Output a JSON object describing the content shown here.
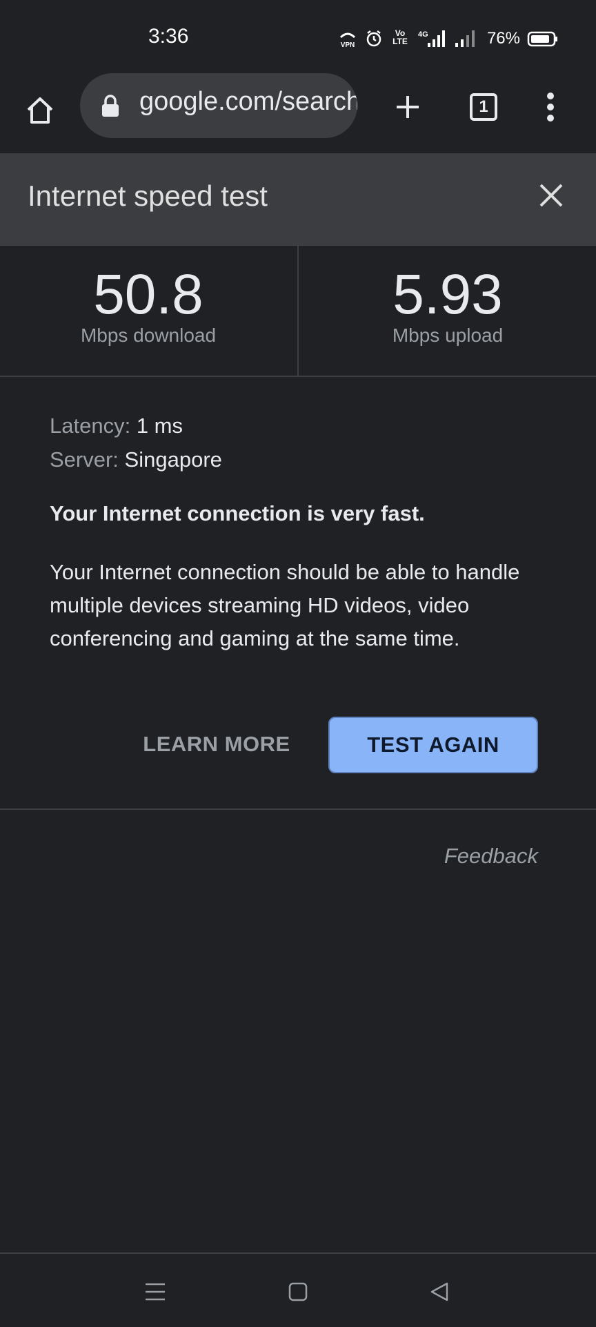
{
  "status_bar": {
    "time": "3:36",
    "battery_percent": "76%",
    "icons": [
      "vpn-icon",
      "alarm-icon",
      "volte-icon",
      "4g-signal-icon",
      "signal-icon",
      "battery-icon"
    ],
    "vpn_label": "VPN",
    "volte_label": "Vo LTE",
    "network_label": "4G"
  },
  "toolbar": {
    "url": "google.com/search",
    "tab_count": "1",
    "icons": [
      "home-icon",
      "lock-icon",
      "plus-icon",
      "tabs-icon",
      "more-vert-icon"
    ]
  },
  "card": {
    "title": "Internet speed test",
    "close_icon": "close-icon"
  },
  "results": {
    "download_value": "50.8",
    "download_unit": "Mbps download",
    "upload_value": "5.93",
    "upload_unit": "Mbps upload"
  },
  "details": {
    "latency_label": "Latency:",
    "latency_value": "1 ms",
    "server_label": "Server:",
    "server_value": "Singapore"
  },
  "headline": "Your Internet connection is very fast.",
  "description": "Your Internet connection should be able to handle multiple devices streaming HD videos, video conferencing and gaming at the same time.",
  "buttons": {
    "learn_more": "LEARN MORE",
    "test_again": "TEST AGAIN"
  },
  "feedback": "Feedback",
  "nav_bar": {
    "icons": [
      "menu-icon",
      "home-square-icon",
      "back-icon"
    ]
  },
  "colors": {
    "background": "#202124",
    "header_bg": "#3c3d41",
    "accent_button": "#8ab4f8",
    "text_primary": "#e8eaed",
    "text_secondary": "#9aa0a6"
  }
}
